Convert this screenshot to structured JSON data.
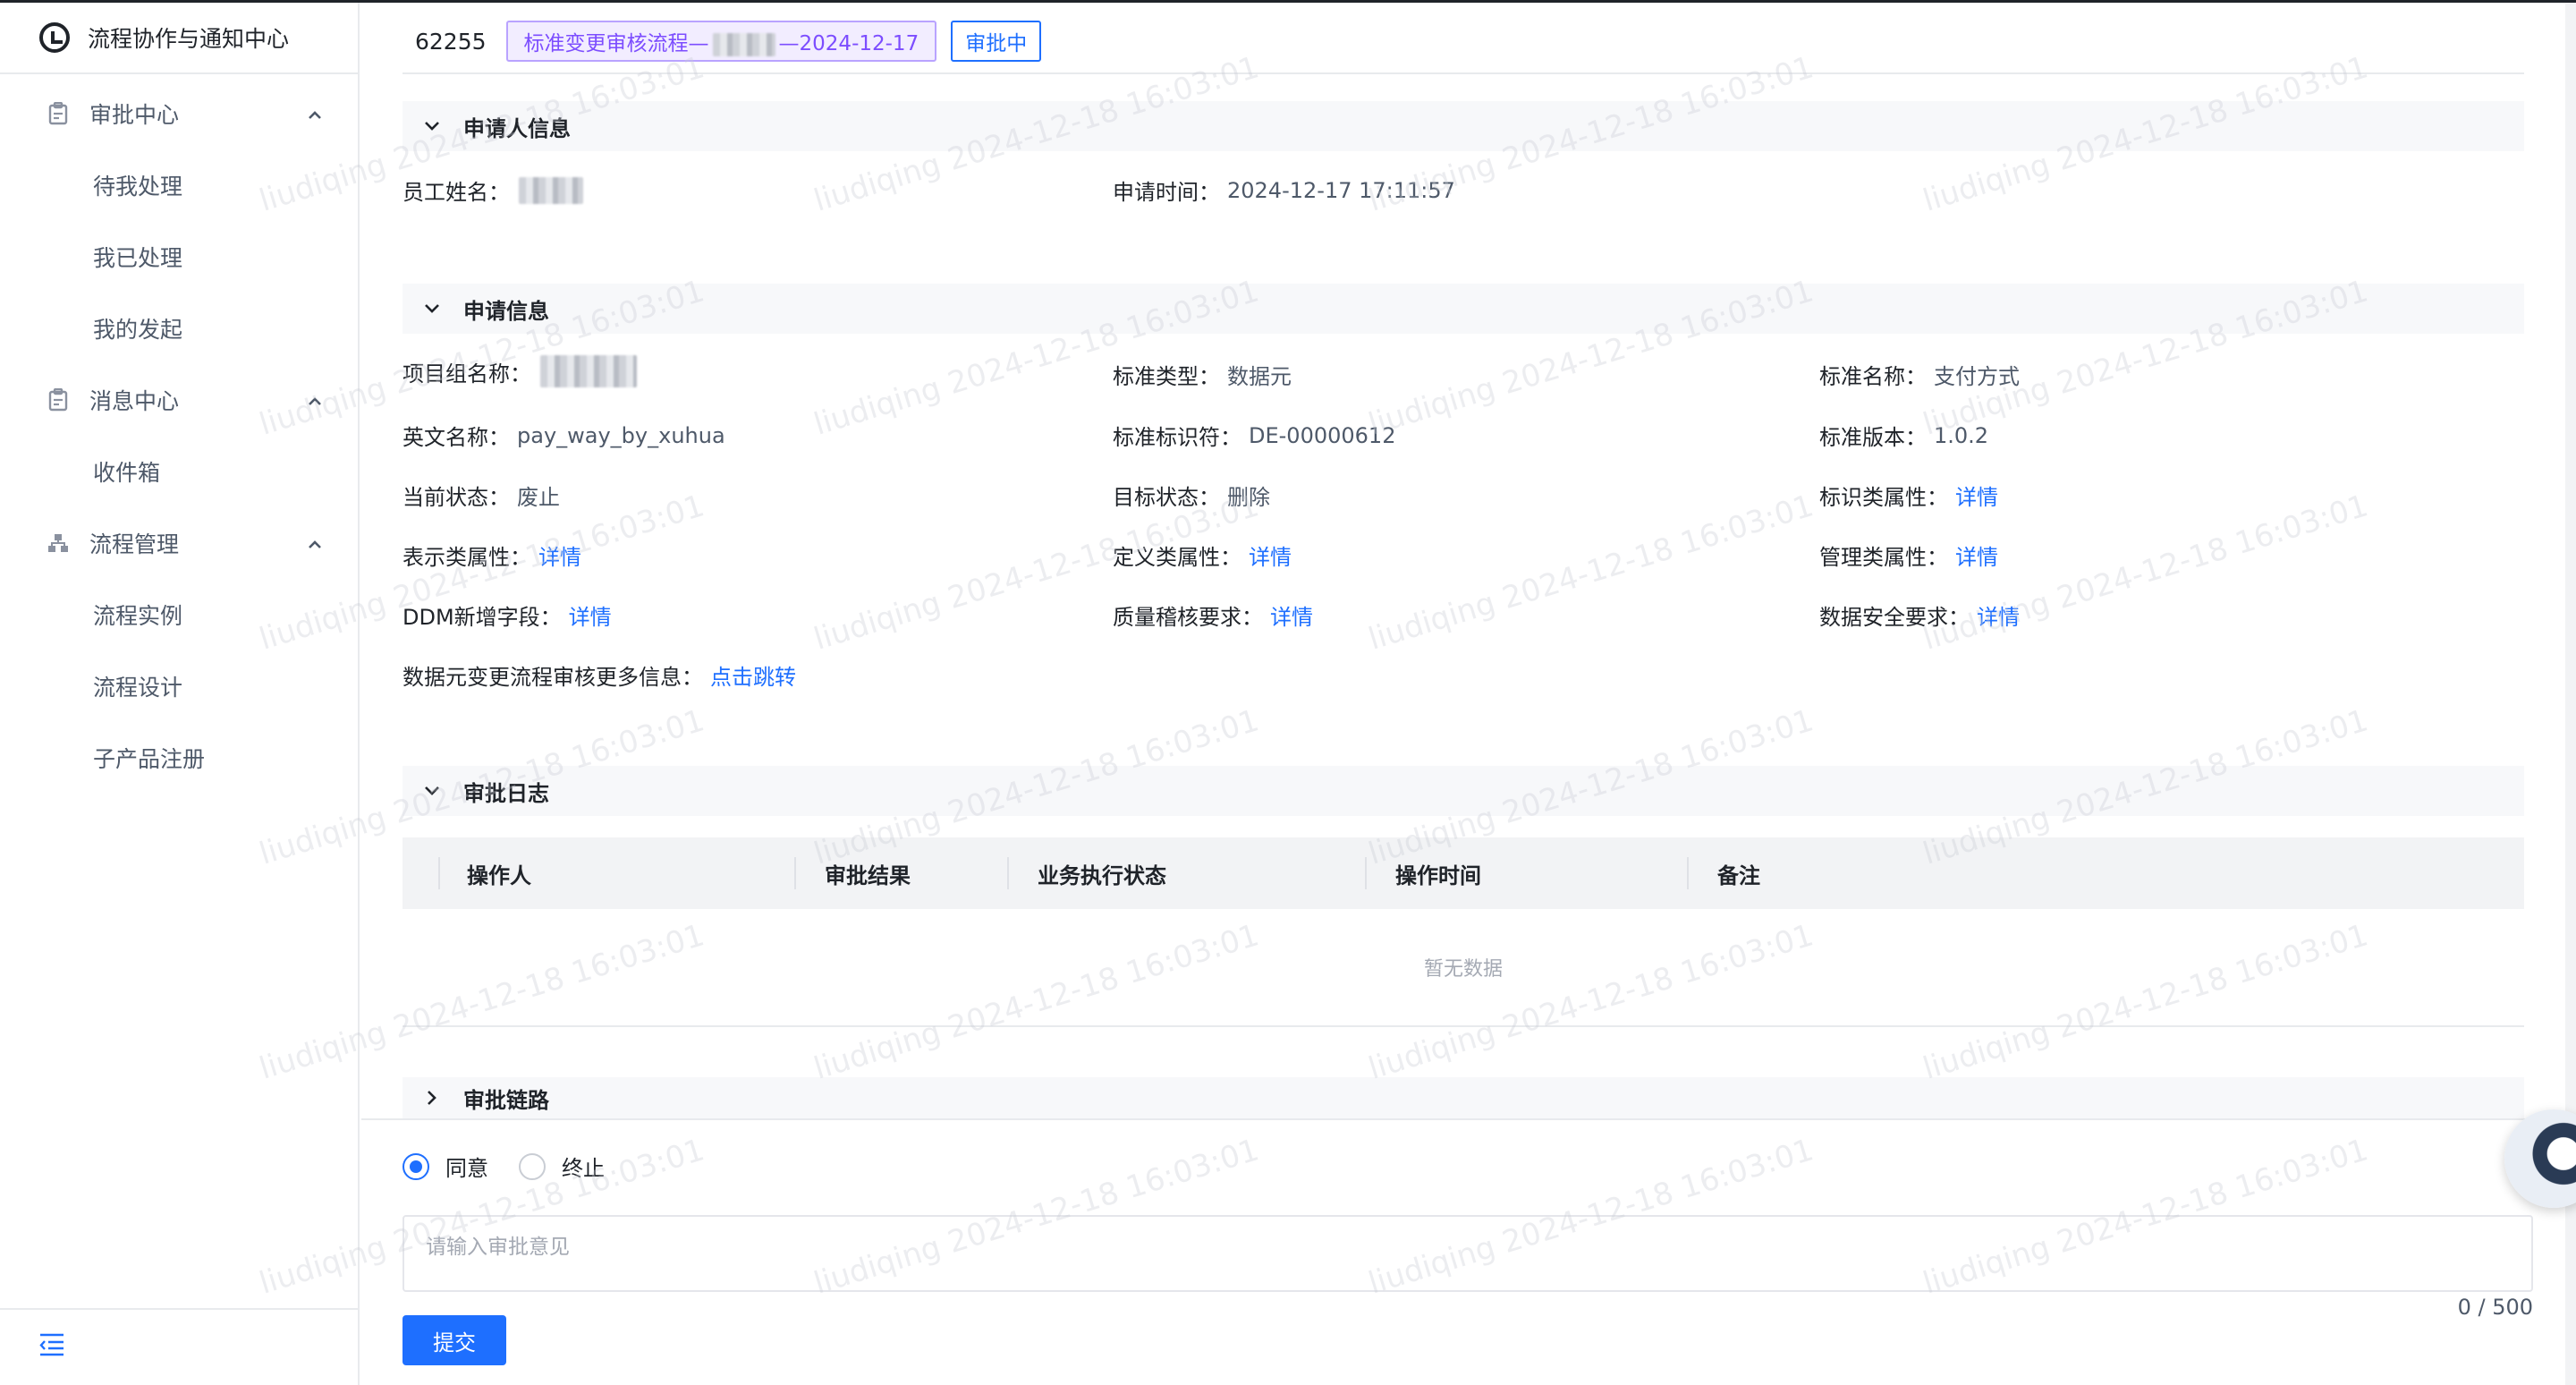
{
  "sidebar": {
    "brand_title": "流程协作与通知中心",
    "groups": [
      {
        "label": "审批中心",
        "icon": "clipboard-icon",
        "items": [
          "待我处理",
          "我已处理",
          "我的发起"
        ]
      },
      {
        "label": "消息中心",
        "icon": "clipboard-icon",
        "items": [
          "收件箱"
        ]
      },
      {
        "label": "流程管理",
        "icon": "org-chart-icon",
        "items": [
          "流程实例",
          "流程设计",
          "子产品注册"
        ]
      }
    ]
  },
  "header": {
    "ticket_no": "62255",
    "flow_name_prefix": "标准变更审核流程—",
    "flow_name_suffix": "—2024-12-17",
    "status": "审批中"
  },
  "applicant": {
    "section_title": "申请人信息",
    "employee_label": "员工姓名：",
    "time_label": "申请时间：",
    "time_value": "2024-12-17 17:11:57"
  },
  "request": {
    "section_title": "申请信息",
    "project_label": "项目组名称：",
    "std_type_label": "标准类型：",
    "std_type_value": "数据元",
    "std_name_label": "标准名称：",
    "std_name_value": "支付方式",
    "en_name_label": "英文名称：",
    "en_name_value": "pay_way_by_xuhua",
    "std_id_label": "标准标识符：",
    "std_id_value": "DE-00000612",
    "std_ver_label": "标准版本：",
    "std_ver_value": "1.0.2",
    "cur_status_label": "当前状态：",
    "cur_status_value": "废止",
    "target_status_label": "目标状态：",
    "target_status_value": "删除",
    "id_attr_label": "标识类属性：",
    "display_attr_label": "表示类属性：",
    "def_attr_label": "定义类属性：",
    "mgmt_attr_label": "管理类属性：",
    "ddm_label": "DDM新增字段：",
    "quality_label": "质量稽核要求：",
    "security_label": "数据安全要求：",
    "detail_link": "详情",
    "more_info_label": "数据元变更流程审核更多信息：",
    "jump_link": "点击跳转"
  },
  "log": {
    "section_title": "审批日志",
    "columns": [
      "操作人",
      "审批结果",
      "业务执行状态",
      "操作时间",
      "备注"
    ],
    "empty_text": "暂无数据"
  },
  "chain": {
    "section_title": "审批链路"
  },
  "action": {
    "agree_label": "同意",
    "terminate_label": "终止",
    "opinion_placeholder": "请输入审批意见",
    "counter": "0 / 500",
    "submit_label": "提交"
  },
  "watermark": "liudiqing 2024-12-18 16:03:01",
  "colors": {
    "primary": "#1e6fff",
    "tag_purple": "#7c4dff"
  }
}
